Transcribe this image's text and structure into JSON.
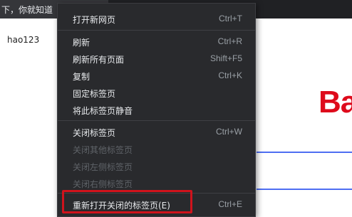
{
  "tab": {
    "title": "下，你就知道",
    "close_glyph": "×"
  },
  "page": {
    "hao123_link": "hao123",
    "logo_text": "Ba"
  },
  "menu": {
    "groups": [
      [
        {
          "label": "打开新网页",
          "shortcut": "Ctrl+T",
          "enabled": true
        }
      ],
      [
        {
          "label": "刷新",
          "shortcut": "Ctrl+R",
          "enabled": true
        },
        {
          "label": "刷新所有页面",
          "shortcut": "Shift+F5",
          "enabled": true
        },
        {
          "label": "复制",
          "shortcut": "Ctrl+K",
          "enabled": true
        },
        {
          "label": "固定标签页",
          "shortcut": "",
          "enabled": true
        },
        {
          "label": "将此标签页静音",
          "shortcut": "",
          "enabled": true
        }
      ],
      [
        {
          "label": "关闭标签页",
          "shortcut": "Ctrl+W",
          "enabled": true
        },
        {
          "label": "关闭其他标签页",
          "shortcut": "",
          "enabled": false
        },
        {
          "label": "关闭左侧标签页",
          "shortcut": "",
          "enabled": false
        },
        {
          "label": "关闭右侧标签页",
          "shortcut": "",
          "enabled": false
        }
      ],
      [
        {
          "label": "重新打开关闭的标签页(E)",
          "shortcut": "Ctrl+E",
          "enabled": true,
          "highlighted": true
        }
      ]
    ]
  },
  "colors": {
    "menu_bg": "#292a2d",
    "highlight_border": "#d0131c",
    "logo": "#de0a1b"
  }
}
